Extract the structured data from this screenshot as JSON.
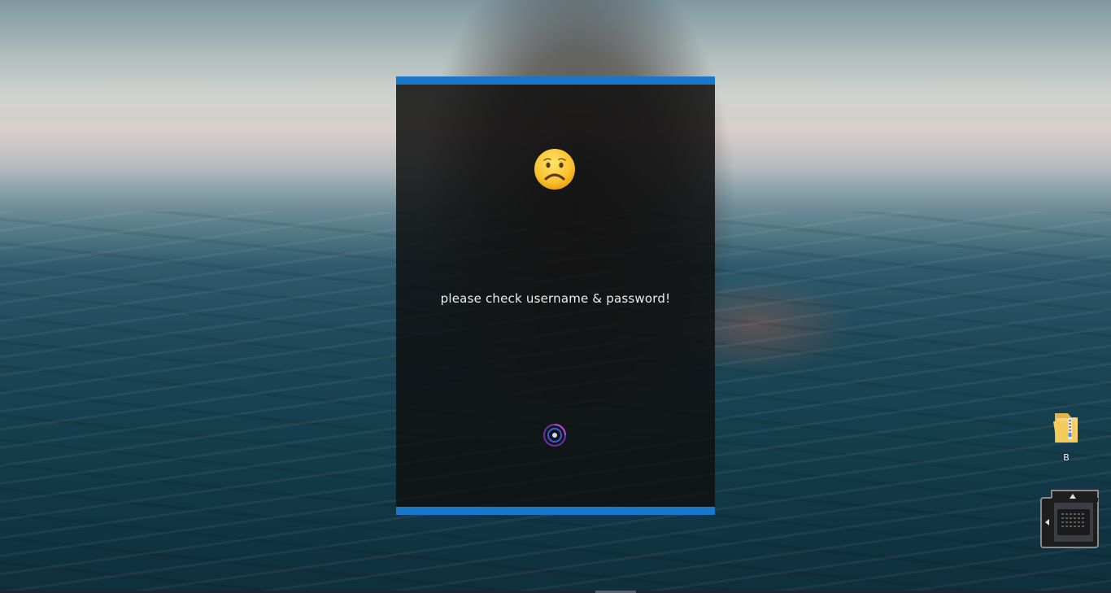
{
  "login_panel": {
    "message": "please check username & password!",
    "accent_color": "#1877c9",
    "status_icon": "sad-face-icon",
    "loading_icon": "spinner-icon"
  },
  "desktop": {
    "icons": [
      {
        "label": "B",
        "icon": "zip-folder-icon"
      }
    ],
    "tray_widget_icon": "keyboard-grid-icon"
  }
}
